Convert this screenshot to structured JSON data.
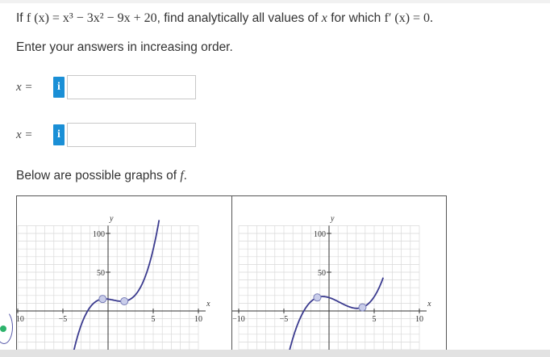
{
  "question": {
    "prefix": "If ",
    "function_expr": "f (x) = x³ − 3x² − 9x + 20",
    "middle": ", find analytically all values of ",
    "var": "x",
    "suffix": " for which ",
    "deriv_expr": "f′ (x) = 0."
  },
  "instruction": "Enter your answers in increasing order.",
  "answers": [
    {
      "label": "x =",
      "info": "i",
      "value": ""
    },
    {
      "label": "x =",
      "info": "i",
      "value": ""
    }
  ],
  "graphs_caption": {
    "text": "Below are possible graphs of ",
    "func": "f",
    "period": "."
  },
  "graphs": [
    {
      "y_axis_label": "y",
      "x_axis_label": "x",
      "y_tick_labels": [
        "100",
        "50"
      ],
      "x_tick_labels": [
        "−10",
        "−5",
        "5",
        "10"
      ]
    },
    {
      "y_axis_label": "y",
      "x_axis_label": "x",
      "y_tick_labels": [
        "100",
        "50"
      ],
      "x_tick_labels": [
        "−10",
        "−5",
        "5",
        "10"
      ]
    }
  ],
  "colors": {
    "info_button": "#1a8fd6",
    "curve": "#3b3b8f",
    "point_fill": "#c9cdea",
    "grid": "#d9d9d9"
  }
}
